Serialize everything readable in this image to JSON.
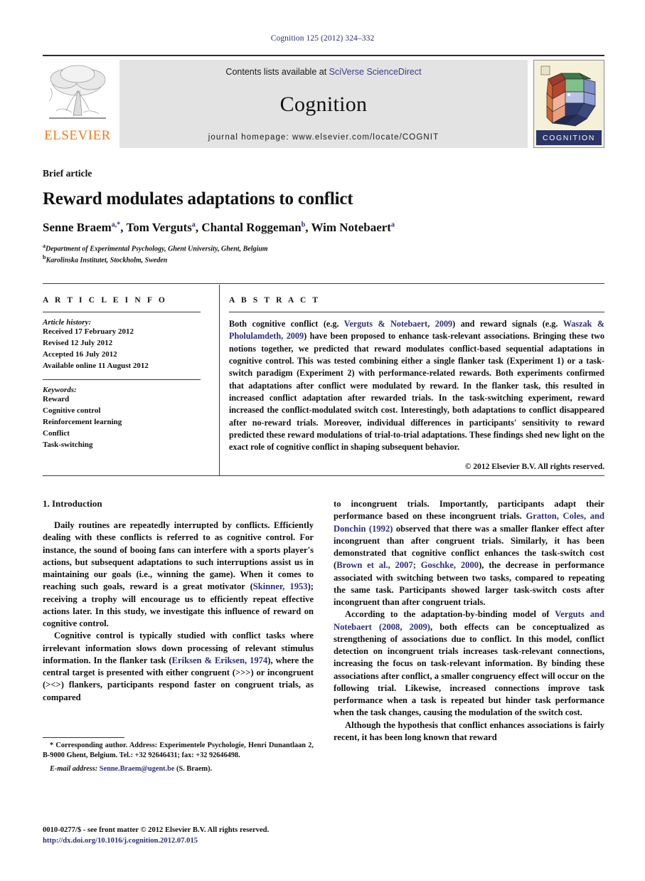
{
  "running_head": "Cognition 125 (2012) 324–332",
  "masthead": {
    "contents_prefix": "Contents lists available at ",
    "contents_link": "SciVerse ScienceDirect",
    "journal_name": "Cognition",
    "homepage": "journal homepage: www.elsevier.com/locate/COGNIT",
    "publisher_wordmark": "ELSEVIER",
    "cover_caption": "COGNITION"
  },
  "article": {
    "type_label": "Brief article",
    "title": "Reward modulates adaptations to conflict",
    "authors": [
      {
        "name": "Senne Braem",
        "marks": "a,*"
      },
      {
        "name": "Tom Verguts",
        "marks": "a"
      },
      {
        "name": "Chantal Roggeman",
        "marks": "b"
      },
      {
        "name": "Wim Notebaert",
        "marks": "a"
      }
    ],
    "affiliations": [
      {
        "mark": "a",
        "text": "Department of Experimental Psychology, Ghent University, Ghent, Belgium"
      },
      {
        "mark": "b",
        "text": "Karolinska Institutet, Stockholm, Sweden"
      }
    ]
  },
  "info": {
    "section_label": "A R T I C L E   I N F O",
    "history_title": "Article history:",
    "history": [
      "Received 17 February 2012",
      "Revised 12 July 2012",
      "Accepted 16 July 2012",
      "Available online 11 August 2012"
    ],
    "keywords_title": "Keywords:",
    "keywords": [
      "Reward",
      "Cognitive control",
      "Reinforcement learning",
      "Conflict",
      "Task-switching"
    ]
  },
  "abstract": {
    "section_label": "A B S T R A C T",
    "copyright": "© 2012 Elsevier B.V. All rights reserved.",
    "p1_a": "Both cognitive conflict (e.g. ",
    "p1_ref1": "Verguts & Notebaert, 2009",
    "p1_b": ") and reward signals (e.g. ",
    "p1_ref2": "Waszak & Pholulamdeth, 2009",
    "p1_c": ") have been proposed to enhance task-relevant associations. Bringing these two notions together, we predicted that reward modulates conflict-based sequential adaptations in cognitive control. This was tested combining either a single flanker task (Experiment 1) or a task-switch paradigm (Experiment 2) with performance-related rewards. Both experiments confirmed that adaptations after conflict were modulated by reward. In the flanker task, this resulted in increased conflict adaptation after rewarded trials. In the task-switching experiment, reward increased the conflict-modulated switch cost. Interestingly, both adaptations to conflict disappeared after no-reward trials. Moreover, individual differences in participants' sensitivity to reward predicted these reward modulations of trial-to-trial adaptations. These findings shed new light on the exact role of cognitive conflict in shaping subsequent behavior."
  },
  "body": {
    "section_1_heading": "1. Introduction",
    "left": {
      "p1_a": "Daily routines are repeatedly interrupted by conflicts. Efficiently dealing with these conflicts is referred to as cognitive control. For instance, the sound of booing fans can interfere with a sports player's actions, but subsequent adaptations to such interruptions assist us in maintaining our goals (i.e., winning the game). When it comes to reaching such goals, reward is a great motivator (",
      "p1_ref1": "Skinner, 1953",
      "p1_b": "); receiving a trophy will encourage us to efficiently repeat effective actions later. In this study, we investigate this influence of reward on cognitive control.",
      "p2_a": "Cognitive control is typically studied with conflict tasks where irrelevant information slows down processing of relevant stimulus information. In the flanker task (",
      "p2_ref1": "Eriksen & Eriksen, 1974",
      "p2_b": "), where the central target is presented with either congruent (>>>) or incongruent (><>) flankers, participants respond faster on congruent trials, as compared"
    },
    "right": {
      "p1_a": "to incongruent trials. Importantly, participants adapt their performance based on these incongruent trials. ",
      "p1_ref1": "Gratton, Coles, and Donchin (1992)",
      "p1_b": " observed that there was a smaller flanker effect after incongruent than after congruent trials. Similarly, it has been demonstrated that cognitive conflict enhances the task-switch cost (",
      "p1_ref2": "Brown et al., 2007; Goschke, 2000",
      "p1_c": "), the decrease in performance associated with switching between two tasks, compared to repeating the same task. Participants showed larger task-switch costs after incongruent than after congruent trials.",
      "p2_a": "According to the adaptation-by-binding model of ",
      "p2_ref1": "Verguts and Notebaert (2008, 2009)",
      "p2_b": ", both effects can be conceptualized as strengthening of associations due to conflict. In this model, conflict detection on incongruent trials increases task-relevant connections, increasing the focus on task-relevant information. By binding these associations after conflict, a smaller congruency effect will occur on the following trial. Likewise, increased connections improve task performance when a task is repeated but hinder task performance when the task changes, causing the modulation of the switch cost.",
      "p3": "Although the hypothesis that conflict enhances associations is fairly recent, it has been long known that reward"
    }
  },
  "footnotes": {
    "corresponding_a": "* Corresponding author. Address: Experimentele Psychologie, Henri Dunantlaan 2, B-9000 Ghent, Belgium. Tel.: +32 92646431; fax: +32 92646498.",
    "email_label": "E-mail address:",
    "email_link": "Senne.Braem@ugent.be",
    "email_suffix": " (S. Braem)."
  },
  "footer": {
    "issn_line": "0010-0277/$ - see front matter © 2012 Elsevier B.V. All rights reserved.",
    "doi": "http://dx.doi.org/10.1016/j.cognition.2012.07.015"
  },
  "colors": {
    "link": "#2d2d7a",
    "elsevier_orange": "#ef7d22",
    "masthead_grey": "#e3e3e3",
    "cover_navy": "#2b3566"
  }
}
